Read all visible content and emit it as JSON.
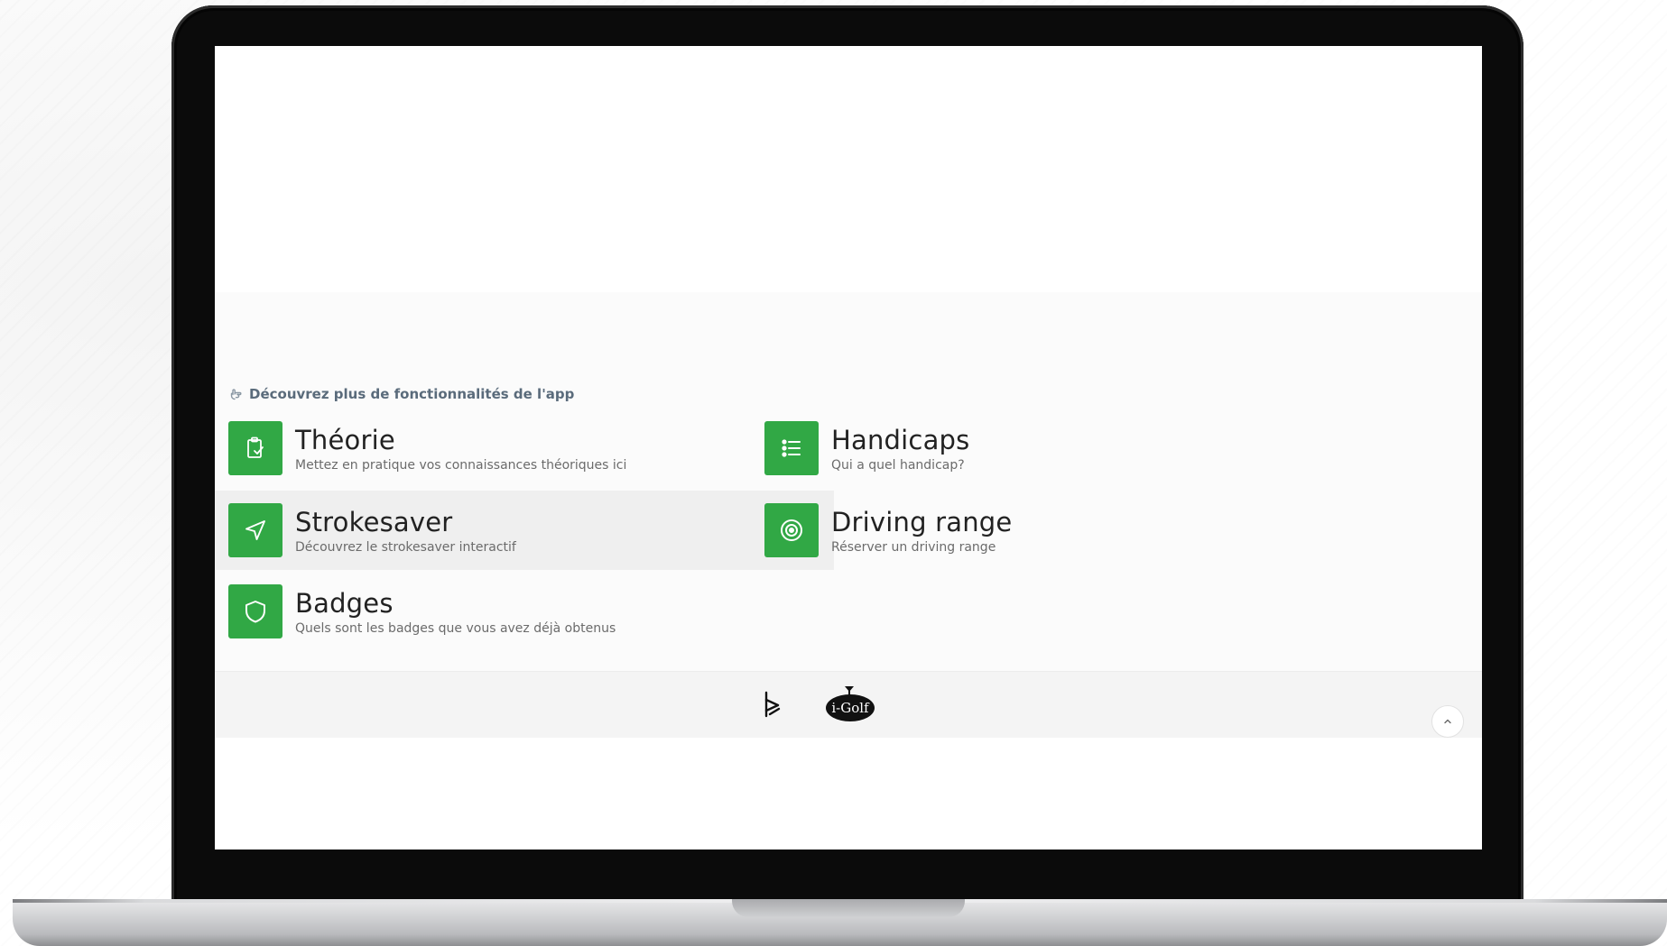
{
  "section": {
    "heading": "Découvrez plus de fonctionnalités de l'app",
    "heading_icon": "hand-pointer-icon"
  },
  "features": {
    "theorie": {
      "title": "Théorie",
      "subtitle": "Mettez en pratique vos connaissances théoriques ici",
      "icon": "clipboard-check-icon"
    },
    "handicaps": {
      "title": "Handicaps",
      "subtitle": "Qui a quel handicap?",
      "icon": "list-icon"
    },
    "strokesaver": {
      "title": "Strokesaver",
      "subtitle": "Découvrez le strokesaver interactif",
      "icon": "navigation-arrow-icon",
      "active": true
    },
    "driving_range": {
      "title": "Driving range",
      "subtitle": "Réserver un driving range",
      "icon": "target-icon"
    },
    "badges": {
      "title": "Badges",
      "subtitle": "Quels sont les badges que vous avez déjà obtenus",
      "icon": "shield-icon"
    }
  },
  "footer": {
    "logo_text": "i-Golf",
    "scroll_top_icon": "chevron-up-icon"
  },
  "colors": {
    "accent": "#31a845",
    "heading": "#5a6b7b",
    "active_row": "#efefef"
  }
}
